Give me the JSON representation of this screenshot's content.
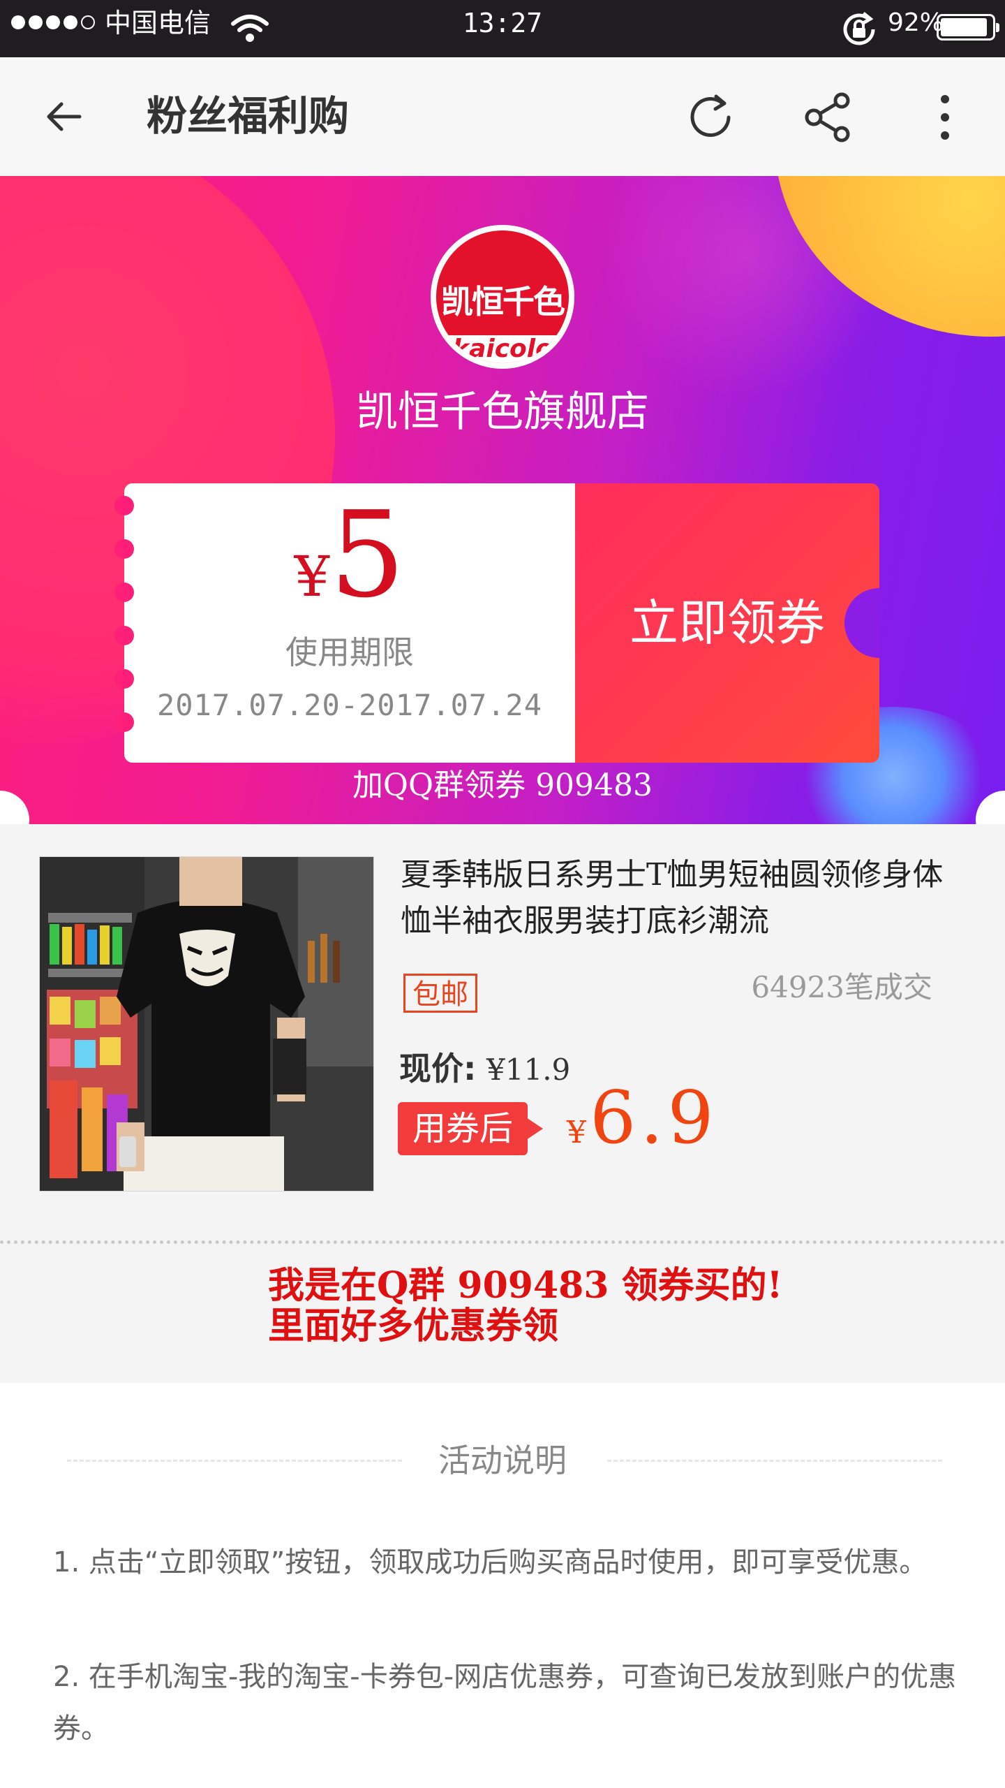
{
  "status_bar": {
    "carrier": "中国电信",
    "time": "13:27",
    "battery_percent": "92%",
    "battery_level": 0.92,
    "signal_bars_filled": 4,
    "signal_bars_total": 5
  },
  "nav": {
    "title": "粉丝福利购"
  },
  "store": {
    "logo_text": "凯恒千色",
    "logo_sub": "kaicolo",
    "name": "凯恒千色旗舰店"
  },
  "coupon": {
    "currency": "¥",
    "amount": "5",
    "validity_label": "使用期限",
    "validity_dates": "2017.07.20-2017.07.24",
    "claim_label": "立即领券"
  },
  "qq_group_text": "加QQ群领券 909483",
  "product": {
    "title": "夏季韩版日系男士T恤男短袖圆领修身体恤半袖衣服男装打底衫潮流",
    "free_shipping": "包邮",
    "sales": "64923笔成交",
    "price_label": "现价:",
    "price_value": "¥11.9",
    "after_coupon_label": "用券后",
    "after_coupon_currency": "¥",
    "after_coupon_price": "6.9"
  },
  "promo": {
    "line1": "我是在Q群 909483 领券买的!",
    "line2": "里面好多优惠券领"
  },
  "rules": {
    "title": "活动说明",
    "items": [
      "1. 点击“立即领取”按钮，领取成功后购买商品时使用，即可享受优惠。",
      "2. 在手机淘宝-我的淘宝-卡券包-网店优惠券，可查询已发放到账户的优惠券。"
    ]
  },
  "colors": {
    "accent_red": "#d40d1f",
    "claim_button": "#ff3a4f",
    "after_coupon_tag": "#f23b3b",
    "after_coupon_price": "#f04511",
    "promo_text": "#e01010",
    "banner_pink": "#ff1f78",
    "banner_purple": "#7a1ef0"
  },
  "icons": {
    "back": "arrow-left-icon",
    "refresh": "refresh-icon",
    "share": "share-icon",
    "more": "more-vertical-icon",
    "wifi": "wifi-icon",
    "rotation_lock": "rotation-lock-icon"
  }
}
